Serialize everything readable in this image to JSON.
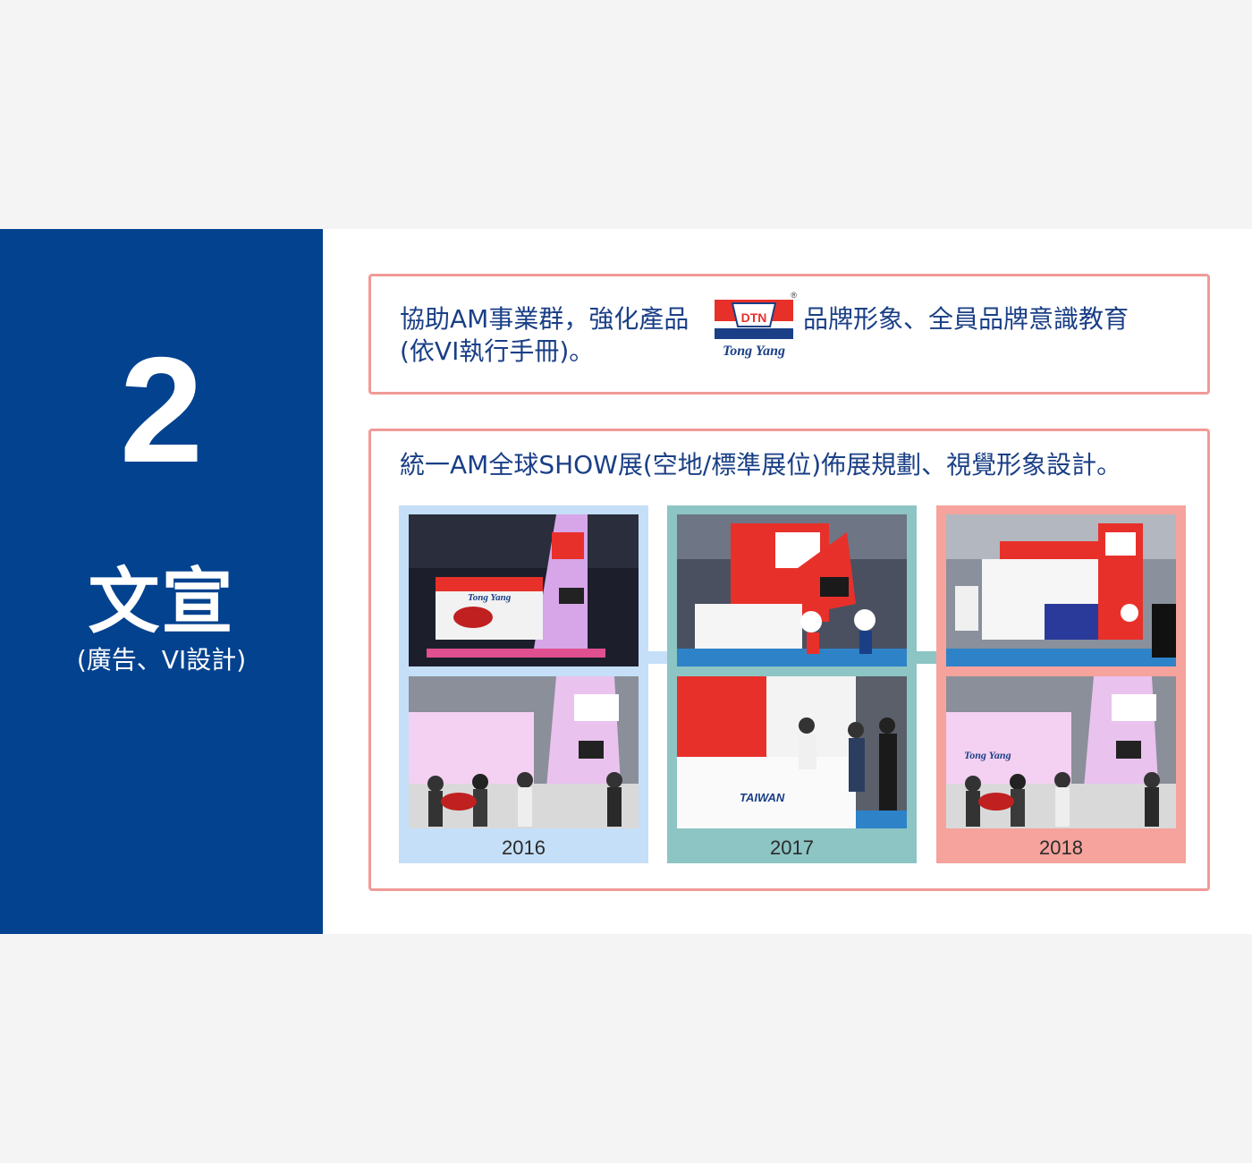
{
  "sidebar": {
    "number": "2",
    "title": "文宣",
    "subtitle": "(廣告、VI設計)"
  },
  "box1": {
    "line1_before_logo": "協助AM事業群，強化產品",
    "line1_after_logo": "品牌形象、全員品牌意識教育",
    "line2": "(依VI執行手冊)。",
    "logo": {
      "emblem_text": "DTN",
      "wordmark": "Tong Yang",
      "registered": "®"
    }
  },
  "box2": {
    "heading": "統一AM全球SHOW展(空地/標準展位)佈展規劃、視覺形象設計。",
    "panels": [
      {
        "year": "2016",
        "color": "#c5dff8",
        "booth_sign": "Tong Yang"
      },
      {
        "year": "2017",
        "color": "#8dc4c4",
        "booth_sign": "TAIWAN"
      },
      {
        "year": "2018",
        "color": "#f5a39c",
        "booth_sign": "Tong Yang"
      }
    ]
  },
  "colors": {
    "sidebar": "#03428f",
    "accent_border": "#f19a97",
    "text": "#1a3f86",
    "booth_red": "#e8302a"
  }
}
